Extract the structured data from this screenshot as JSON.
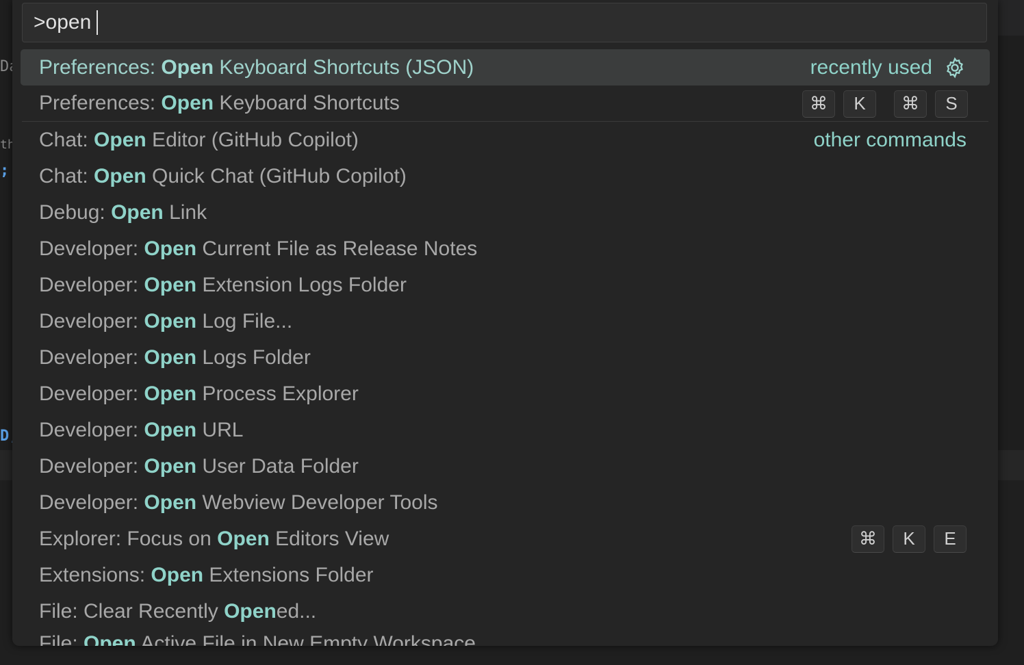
{
  "background": {
    "fragments": [
      "Da",
      "th",
      ";",
      "D;"
    ]
  },
  "quick_pick": {
    "input_value": ">open",
    "items": [
      {
        "prefix": "Preferences: ",
        "match": "Open",
        "suffix": " Keyboard Shortcuts (JSON)",
        "group": "recently used",
        "icon": "gear-icon",
        "keys": []
      },
      {
        "prefix": "Preferences: ",
        "match": "Open",
        "suffix": " Keyboard Shortcuts",
        "group": "",
        "keys": [
          "⌘",
          "K",
          "⌘",
          "S"
        ]
      },
      {
        "prefix": "Chat: ",
        "match": "Open",
        "suffix": " Editor (GitHub Copilot)",
        "group": "other commands",
        "keys": []
      },
      {
        "prefix": "Chat: ",
        "match": "Open",
        "suffix": " Quick Chat (GitHub Copilot)",
        "group": "",
        "keys": []
      },
      {
        "prefix": "Debug: ",
        "match": "Open",
        "suffix": " Link",
        "group": "",
        "keys": []
      },
      {
        "prefix": "Developer: ",
        "match": "Open",
        "suffix": " Current File as Release Notes",
        "group": "",
        "keys": []
      },
      {
        "prefix": "Developer: ",
        "match": "Open",
        "suffix": " Extension Logs Folder",
        "group": "",
        "keys": []
      },
      {
        "prefix": "Developer: ",
        "match": "Open",
        "suffix": " Log File...",
        "group": "",
        "keys": []
      },
      {
        "prefix": "Developer: ",
        "match": "Open",
        "suffix": " Logs Folder",
        "group": "",
        "keys": []
      },
      {
        "prefix": "Developer: ",
        "match": "Open",
        "suffix": " Process Explorer",
        "group": "",
        "keys": []
      },
      {
        "prefix": "Developer: ",
        "match": "Open",
        "suffix": " URL",
        "group": "",
        "keys": []
      },
      {
        "prefix": "Developer: ",
        "match": "Open",
        "suffix": " User Data Folder",
        "group": "",
        "keys": []
      },
      {
        "prefix": "Developer: ",
        "match": "Open",
        "suffix": " Webview Developer Tools",
        "group": "",
        "keys": []
      },
      {
        "prefix": "Explorer: Focus on ",
        "match": "Open",
        "suffix": " Editors View",
        "group": "",
        "keys": [
          "⌘",
          "K",
          "E"
        ]
      },
      {
        "prefix": "Extensions: ",
        "match": "Open",
        "suffix": " Extensions Folder",
        "group": "",
        "keys": []
      },
      {
        "prefix": "File: Clear Recently ",
        "match": "Open",
        "suffix": "ed...",
        "group": "",
        "keys": []
      },
      {
        "prefix": "File: ",
        "match": "Open",
        "suffix": " Active File in New Empty Workspace",
        "group": "",
        "keys": []
      }
    ]
  },
  "colors": {
    "highlight": "#8fd3c9",
    "selected_background": "#3b3d3d",
    "panel_background": "#252525"
  }
}
